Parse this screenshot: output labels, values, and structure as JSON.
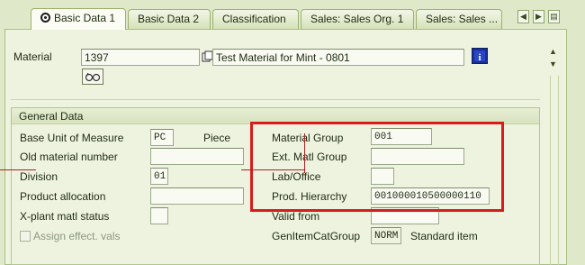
{
  "tabs": [
    {
      "label": "Basic Data 1",
      "active": true
    },
    {
      "label": "Basic Data 2",
      "active": false
    },
    {
      "label": "Classification",
      "active": false
    },
    {
      "label": "Sales: Sales Org. 1",
      "active": false
    },
    {
      "label": "Sales: Sales ...",
      "active": false
    }
  ],
  "header": {
    "material_label": "Material",
    "material_value": "1397",
    "material_desc": "Test Material for Mint - 0801"
  },
  "general_data": {
    "title": "General Data",
    "base_uom_label": "Base Unit of Measure",
    "base_uom_value": "PC",
    "base_uom_text": "Piece",
    "old_material_label": "Old material number",
    "old_material_value": "",
    "division_label": "Division",
    "division_value": "01",
    "product_allocation_label": "Product allocation",
    "product_allocation_value": "",
    "xplant_status_label": "X-plant matl status",
    "xplant_status_value": "",
    "assign_effect_label": "Assign effect. vals",
    "material_group_label": "Material Group",
    "material_group_value": "001",
    "ext_matl_group_label": "Ext. Matl Group",
    "ext_matl_group_value": "",
    "lab_office_label": "Lab/Office",
    "lab_office_value": "",
    "prod_hierarchy_label": "Prod. Hierarchy",
    "prod_hierarchy_value": "001000010500000110",
    "valid_from_label": "Valid from",
    "valid_from_value": "",
    "gen_item_cat_label": "GenItemCatGroup",
    "gen_item_cat_value": "NORM",
    "gen_item_cat_text": "Standard item"
  },
  "colors": {
    "highlight": "#d81b1b",
    "background": "#dfe9c9",
    "panel": "#eef3df"
  }
}
